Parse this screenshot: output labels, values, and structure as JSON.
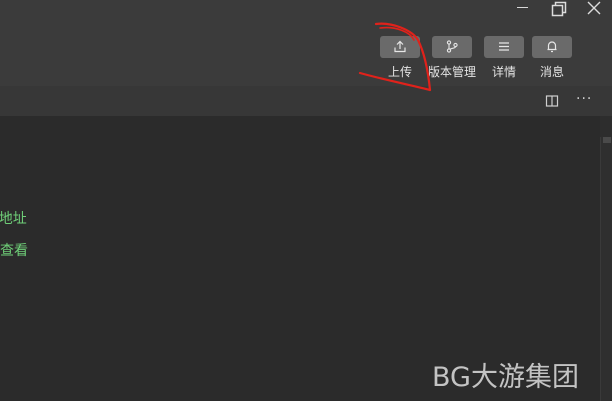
{
  "window_controls": {
    "minimize_icon": "minimize-icon",
    "maximize_icon": "restore-icon",
    "close_icon": "close-icon"
  },
  "toolbar": {
    "items": [
      {
        "label": "上传",
        "icon": "upload-icon"
      },
      {
        "label": "版本管理",
        "icon": "git-branch-icon"
      },
      {
        "label": "详情",
        "icon": "menu-lines-icon"
      },
      {
        "label": "消息",
        "icon": "bell-icon"
      }
    ],
    "button_color": "#6a6a6a"
  },
  "tabbar": {
    "split_icon": "split-editor-icon",
    "more_icon": "more-icon",
    "more_glyph": "···"
  },
  "editor": {
    "lines": [
      "pi地址",
      "中查看"
    ],
    "text_color": "#6fcf78"
  },
  "watermark": {
    "text": "BG大游集团"
  },
  "annotation": {
    "color": "#e0221b"
  }
}
